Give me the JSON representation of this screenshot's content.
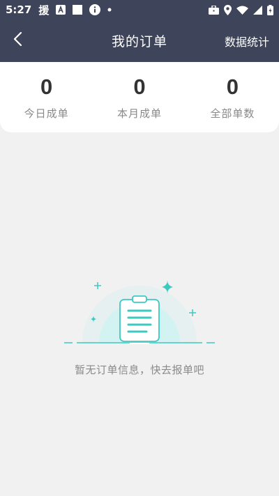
{
  "status_bar": {
    "time": "5:27",
    "left_icons": [
      "yuan-app-icon",
      "font-a-icon",
      "square-icon",
      "info-icon",
      "dot-icon"
    ],
    "yuan_glyph": "援",
    "right_icons": [
      "briefcase-icon",
      "location-icon",
      "wifi-icon",
      "signal-icon",
      "battery-icon"
    ]
  },
  "header": {
    "title": "我的订单",
    "action_label": "数据统计",
    "back_icon": "chevron-left-icon"
  },
  "stats": [
    {
      "value": "0",
      "label": "今日成单"
    },
    {
      "value": "0",
      "label": "本月成单"
    },
    {
      "value": "0",
      "label": "全部单数"
    }
  ],
  "empty_state": {
    "illustration": "clipboard-icon",
    "message": "暂无订单信息，快去报单吧"
  },
  "colors": {
    "header_bg": "#3e4459",
    "page_bg": "#f1f1f1",
    "accent": "#3cc9c0"
  }
}
